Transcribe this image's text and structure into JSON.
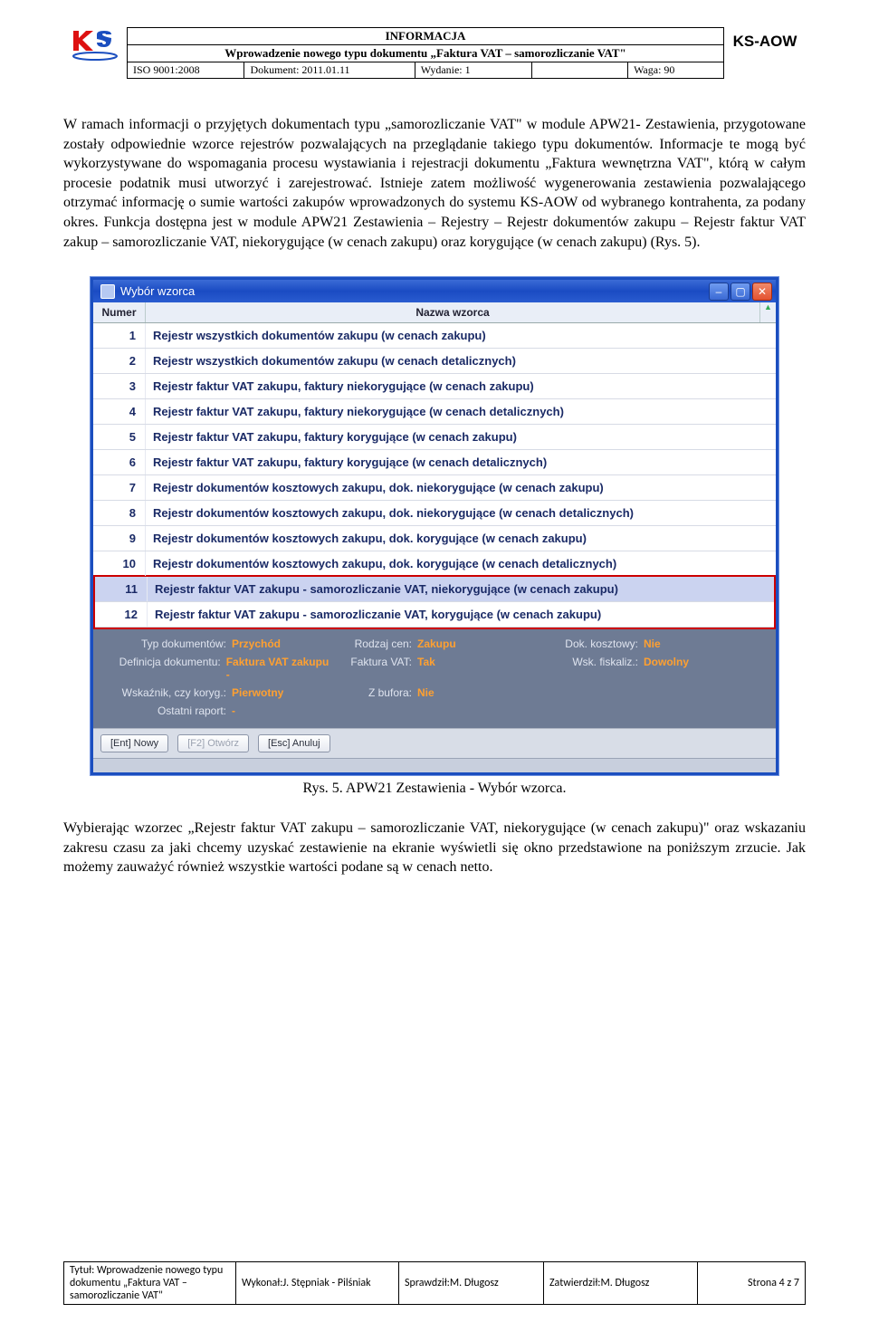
{
  "header": {
    "info": "INFORMACJA",
    "subtitle": "Wprowadzenie nowego typu dokumentu „Faktura VAT – samorozliczanie VAT\"",
    "iso": "ISO 9001:2008",
    "dok_label": "Dokument: 2011.01.11",
    "wyd_label": "Wydanie: 1",
    "waga_label": "Waga: 90",
    "brand": "KS-AOW"
  },
  "para1": "W ramach informacji o przyjętych dokumentach typu „samorozliczanie VAT\" w module APW21- Zestawienia, przygotowane zostały odpowiednie wzorce rejestrów pozwalających na przeglądanie takiego typu dokumentów. Informacje te mogą być wykorzystywane do wspomagania procesu wystawiania i rejestracji dokumentu „Faktura wewnętrzna VAT\", którą w całym procesie podatnik musi utworzyć i zarejestrować. Istnieje zatem możliwość wygenerowania zestawienia pozwalającego otrzymać informację o sumie wartości zakupów wprowadzonych do systemu KS-AOW od wybranego kontrahenta, za podany okres. Funkcja dostępna jest w module APW21 Zestawienia – Rejestry – Rejestr dokumentów zakupu – Rejestr faktur VAT zakup – samorozliczanie VAT, niekorygujące (w cenach zakupu) oraz korygujące (w cenach zakupu) (Rys. 5).",
  "window": {
    "title": "Wybór wzorca",
    "cols": {
      "num": "Numer",
      "name": "Nazwa wzorca"
    },
    "rows": [
      {
        "n": "1",
        "t": "Rejestr wszystkich dokumentów zakupu (w cenach zakupu)"
      },
      {
        "n": "2",
        "t": "Rejestr wszystkich dokumentów zakupu (w cenach detalicznych)"
      },
      {
        "n": "3",
        "t": "Rejestr faktur VAT zakupu, faktury niekorygujące (w cenach zakupu)"
      },
      {
        "n": "4",
        "t": "Rejestr faktur VAT zakupu, faktury niekorygujące (w cenach detalicznych)"
      },
      {
        "n": "5",
        "t": "Rejestr faktur VAT zakupu, faktury korygujące (w cenach zakupu)"
      },
      {
        "n": "6",
        "t": "Rejestr faktur VAT zakupu, faktury korygujące (w cenach detalicznych)"
      },
      {
        "n": "7",
        "t": "Rejestr dokumentów kosztowych zakupu, dok. niekorygujące (w cenach zakupu)"
      },
      {
        "n": "8",
        "t": "Rejestr dokumentów kosztowych zakupu, dok. niekorygujące (w cenach detalicznych)"
      },
      {
        "n": "9",
        "t": "Rejestr dokumentów kosztowych zakupu, dok. korygujące (w cenach zakupu)"
      },
      {
        "n": "10",
        "t": "Rejestr dokumentów kosztowych zakupu, dok. korygujące (w cenach detalicznych)"
      },
      {
        "n": "11",
        "t": "Rejestr faktur VAT zakupu - samorozliczanie VAT, niekorygujące (w cenach zakupu)"
      },
      {
        "n": "12",
        "t": "Rejestr faktur VAT zakupu - samorozliczanie VAT, korygujące (w cenach zakupu)"
      }
    ],
    "details": {
      "typ_l": "Typ dokumentów:",
      "typ_v": "Przychód",
      "rodz_l": "Rodzaj cen:",
      "rodz_v": "Zakupu",
      "dok_l": "Dok. kosztowy:",
      "dok_v": "Nie",
      "def_l": "Definicja dokumentu:",
      "def_v": "Faktura VAT zakupu -",
      "fvat_l": "Faktura VAT:",
      "fvat_v": "Tak",
      "wfisk_l": "Wsk. fiskaliz.:",
      "wfisk_v": "Dowolny",
      "wsk_l": "Wskaźnik, czy koryg.:",
      "wsk_v": "Pierwotny",
      "buf_l": "Z bufora:",
      "buf_v": "Nie",
      "ost_l": "Ostatni raport:",
      "ost_v": "-"
    },
    "buttons": {
      "nowy": "[Ent] Nowy",
      "otworz": "[F2] Otwórz",
      "anuluj": "[Esc] Anuluj"
    }
  },
  "caption": "Rys. 5. APW21 Zestawienia - Wybór wzorca.",
  "para2": "Wybierając wzorzec „Rejestr faktur VAT zakupu – samorozliczanie VAT, niekorygujące (w cenach zakupu)\" oraz wskazaniu zakresu czasu za jaki chcemy uzyskać zestawienie na ekranie wyświetli się okno przedstawione na poniższym zrzucie. Jak możemy zauważyć również wszystkie wartości podane są w cenach netto.",
  "footer": {
    "tytul": "Tytuł: Wprowadzenie nowego typu dokumentu „Faktura VAT – samorozliczanie VAT\"",
    "wyk": "Wykonał:J. Stępniak - Pilśniak",
    "spr": "Sprawdził:M. Długosz",
    "zat": "Zatwierdził:M. Długosz",
    "str": "Strona 4 z 7"
  }
}
